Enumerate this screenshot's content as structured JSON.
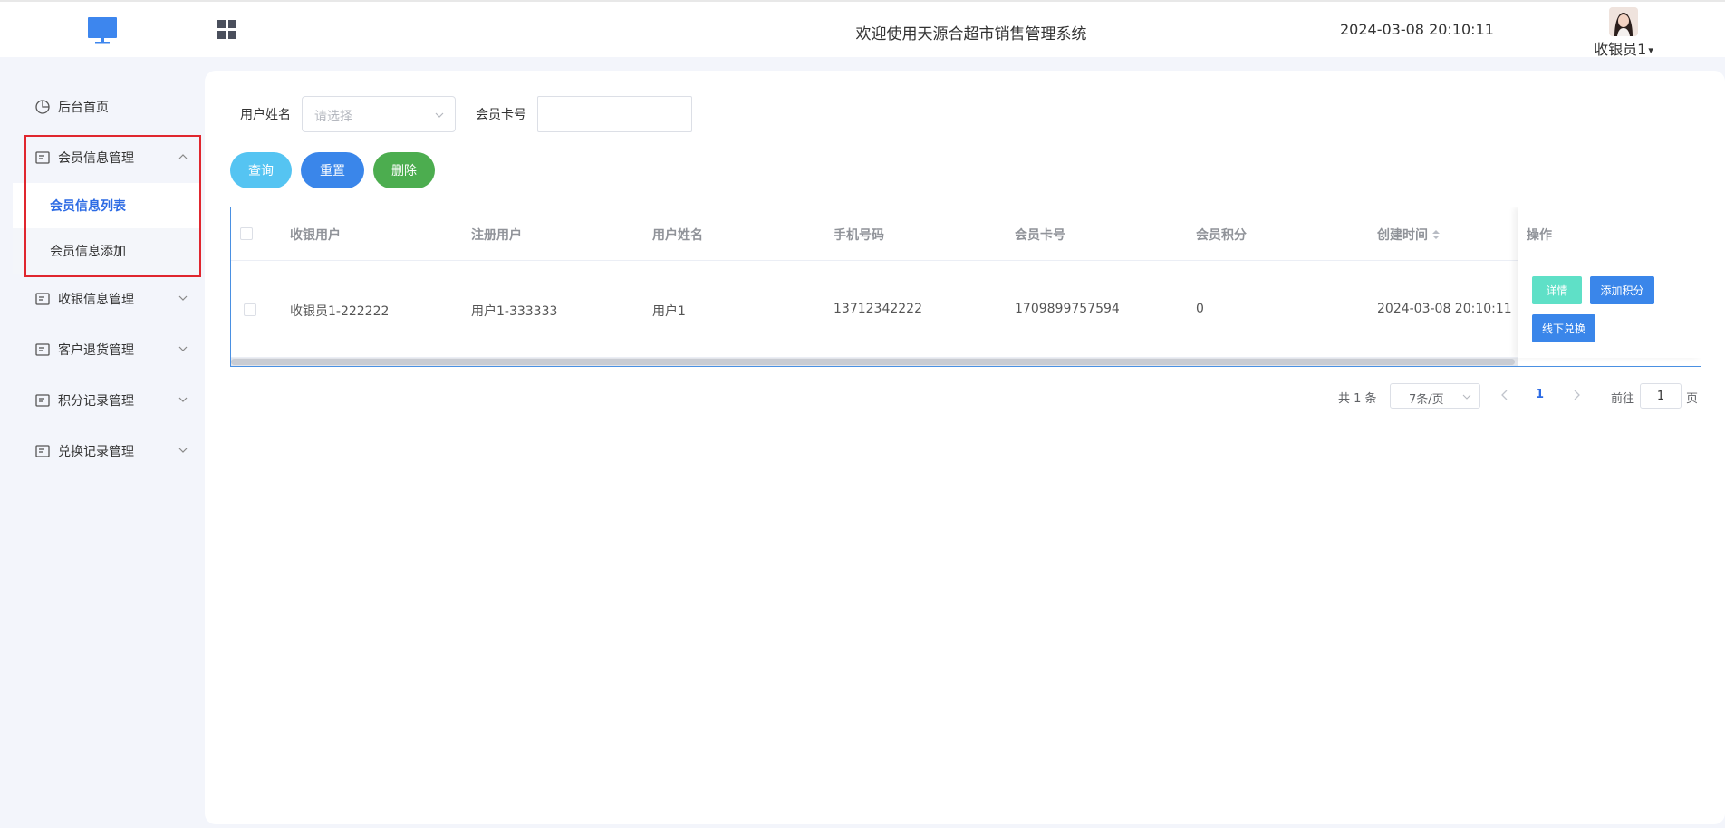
{
  "header": {
    "title": "欢迎使用天源合超市销售管理系统",
    "datetime": "2024-03-08 20:10:11",
    "user_name": "收银员1"
  },
  "sidebar": {
    "home": "后台首页",
    "groups": [
      {
        "label": "会员信息管理",
        "expanded": true,
        "children": [
          "会员信息列表",
          "会员信息添加"
        ]
      },
      {
        "label": "收银信息管理",
        "expanded": false
      },
      {
        "label": "客户退货管理",
        "expanded": false
      },
      {
        "label": "积分记录管理",
        "expanded": false
      },
      {
        "label": "兑换记录管理",
        "expanded": false
      }
    ]
  },
  "filters": {
    "username_label": "用户姓名",
    "username_placeholder": "请选择",
    "card_label": "会员卡号",
    "card_value": ""
  },
  "buttons": {
    "query": "查询",
    "reset": "重置",
    "delete": "删除"
  },
  "table": {
    "columns": [
      "收银用户",
      "注册用户",
      "用户姓名",
      "手机号码",
      "会员卡号",
      "会员积分",
      "创建时间",
      "操作"
    ],
    "rows": [
      {
        "cashier": "收银员1-222222",
        "registered_user": "用户1-333333",
        "name": "用户1",
        "phone": "13712342222",
        "card_no": "1709899757594",
        "points": "0",
        "created_at": "2024-03-08 20:10:11"
      }
    ],
    "actions": [
      "详情",
      "添加积分",
      "线下兑换"
    ]
  },
  "pagination": {
    "total_text": "共 1 条",
    "page_size": "7条/页",
    "current_page": "1",
    "goto_label": "前往",
    "goto_value": "1",
    "page_suffix": "页"
  },
  "colors": {
    "accent": "#2d6be4",
    "query_button": "#55c4f2",
    "reset_button": "#3a86ea",
    "delete_button": "#4cad4f",
    "detail_button": "#5fe0c7",
    "highlight_border": "#e0262e"
  }
}
